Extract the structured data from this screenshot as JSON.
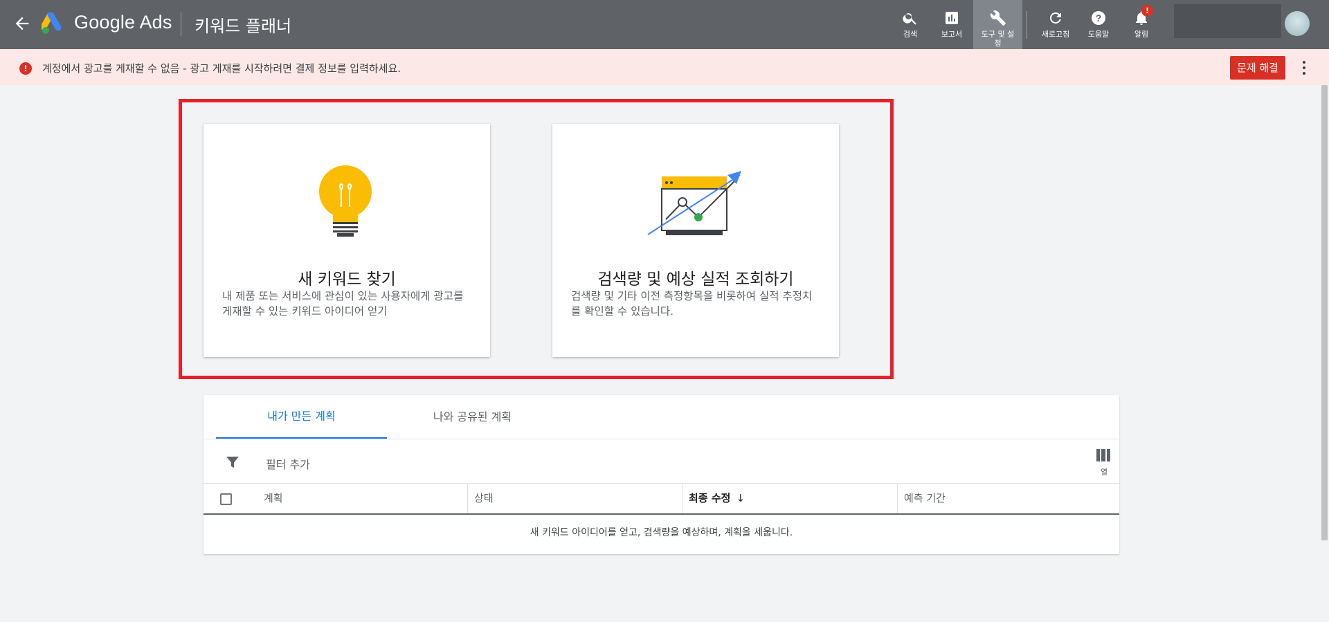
{
  "header": {
    "brand": "Google Ads",
    "page_title": "키워드 플래너",
    "tools": [
      {
        "label": "검색",
        "icon": "search-icon"
      },
      {
        "label": "보고서",
        "icon": "reports-icon"
      },
      {
        "label": "도구 및 설정",
        "icon": "wrench-icon"
      },
      {
        "label": "새로고침",
        "icon": "refresh-icon"
      },
      {
        "label": "도움말",
        "icon": "help-icon"
      },
      {
        "label": "알림",
        "icon": "bell-icon",
        "badge": "!"
      }
    ]
  },
  "alert": {
    "icon": "!",
    "message": "계정에서 광고를 게재할 수 없음 - 광고 게재를 시작하려면 결제 정보를 입력하세요.",
    "fix_button": "문제 해결"
  },
  "cards": {
    "discover": {
      "title": "새 키워드 찾기",
      "description": "내 제품 또는 서비스에 관심이 있는 사용자에게 광고를 게재할 수 있는 키워드 아이디어 얻기"
    },
    "forecast": {
      "title": "검색량 및 예상 실적 조회하기",
      "description": "검색량 및 기타 이전 측정항목을 비롯하여 실적 추정치를 확인할 수 있습니다."
    }
  },
  "plans": {
    "tabs": [
      "내가 만든 계획",
      "나와 공유된 계획"
    ],
    "filter_label": "필터 추가",
    "columns_label": "열",
    "headers": [
      "계획",
      "상태",
      "최종 수정",
      "예측 기간"
    ],
    "sort_arrow": "↓",
    "empty_message": "새 키워드 아이디어를 얻고, 검색량을 예상하며, 계획을 세웁니다."
  },
  "colors": {
    "topbar": "#5f6368",
    "alert_bg": "#fce8e6",
    "error_red": "#d93025",
    "highlight": "#e5222c",
    "accent_blue": "#1a73e8",
    "bulb_yellow": "#fbbc04",
    "chart_green": "#34a853"
  }
}
